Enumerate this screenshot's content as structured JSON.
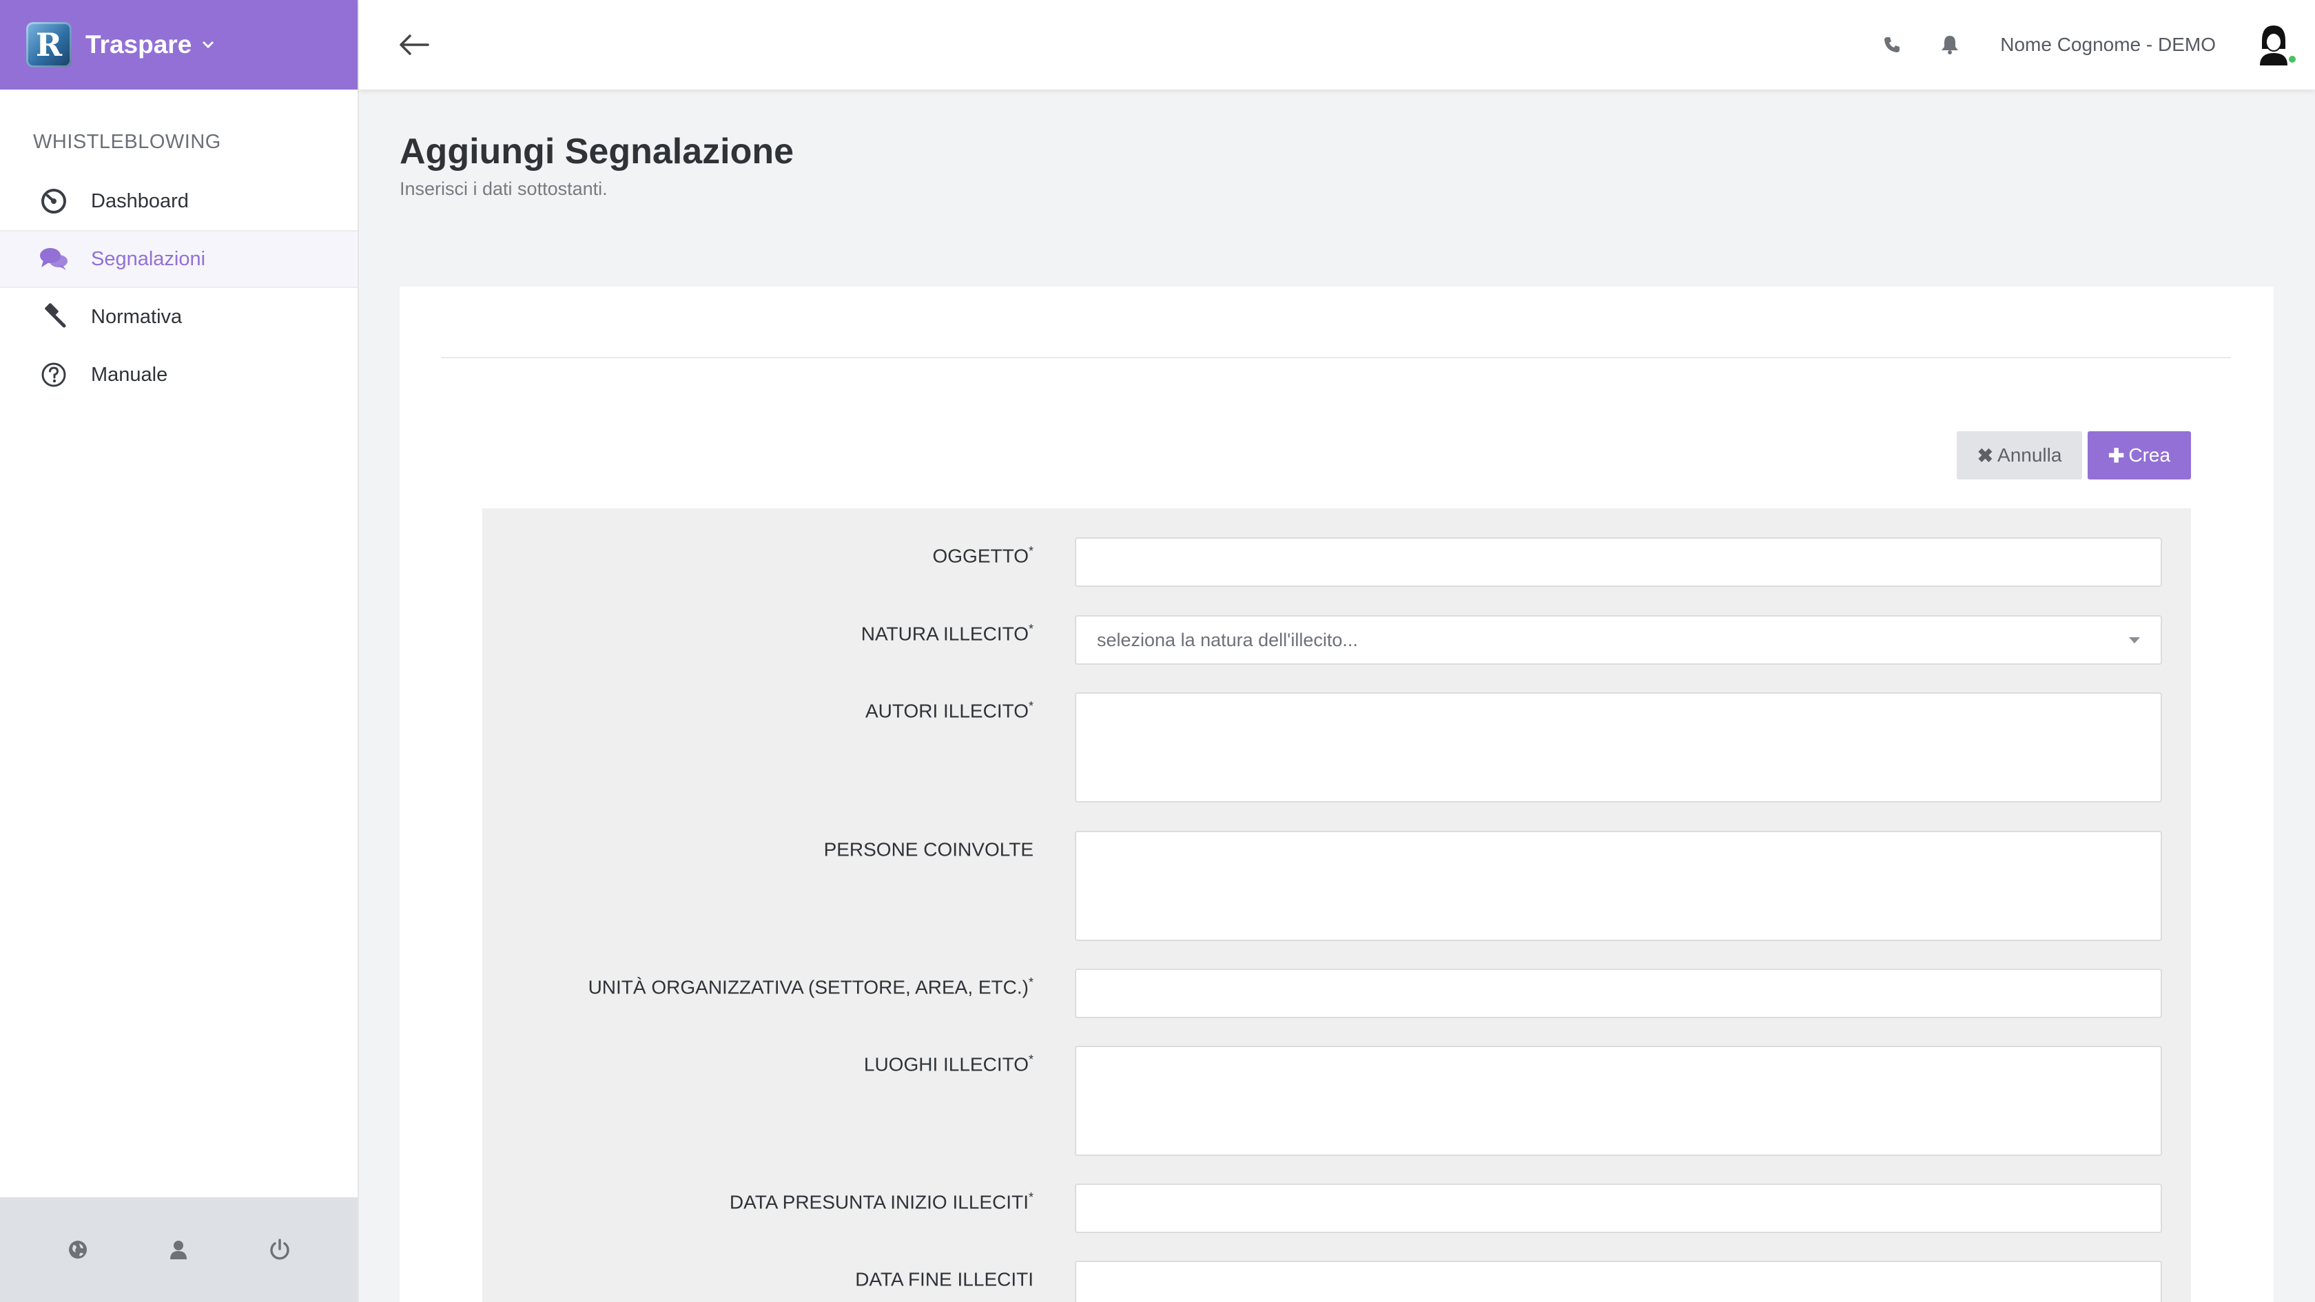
{
  "brand": {
    "name": "Traspare",
    "logo_letter": "R"
  },
  "sidebar": {
    "section_title": "WHISTLEBLOWING",
    "items": [
      {
        "label": "Dashboard",
        "icon": "dashboard-gauge-icon",
        "active": false
      },
      {
        "label": "Segnalazioni",
        "icon": "comments-icon",
        "active": true
      },
      {
        "label": "Normativa",
        "icon": "gavel-icon",
        "active": false
      },
      {
        "label": "Manuale",
        "icon": "help-circle-icon",
        "active": false
      }
    ],
    "footer_icons": [
      "globe-icon",
      "user-icon",
      "power-icon"
    ]
  },
  "topbar": {
    "user_name": "Nome Cognome - DEMO",
    "icons": [
      "back-arrow-icon",
      "phone-icon",
      "bell-icon",
      "avatar"
    ]
  },
  "page": {
    "title": "Aggiungi Segnalazione",
    "subtitle": "Inserisci i dati sottostanti."
  },
  "actions": {
    "cancel_label": "Annulla",
    "create_label": "Crea"
  },
  "form": {
    "fields": [
      {
        "label": "OGGETTO",
        "required": "*",
        "type": "input",
        "value": ""
      },
      {
        "label": "NATURA ILLECITO",
        "required": "*",
        "type": "select",
        "placeholder": "seleziona la natura dell'illecito..."
      },
      {
        "label": "AUTORI ILLECITO",
        "required": "*",
        "type": "textarea",
        "value": ""
      },
      {
        "label": "PERSONE COINVOLTE",
        "required": "",
        "type": "textarea",
        "value": ""
      },
      {
        "label": "UNITÀ ORGANIZZATIVA (SETTORE, AREA, ETC.)",
        "required": "*",
        "type": "input",
        "value": ""
      },
      {
        "label": "LUOGHI ILLECITO",
        "required": "*",
        "type": "textarea",
        "value": ""
      },
      {
        "label": "DATA PRESUNTA INIZIO ILLECITI",
        "required": "*",
        "type": "input",
        "value": ""
      },
      {
        "label": "DATA FINE ILLECITI",
        "required": "",
        "type": "input",
        "value": ""
      }
    ]
  },
  "colors": {
    "accent": "#9270d6",
    "sidebar_footer": "#dde1e5",
    "page_bg": "#f2f3f4",
    "form_panel": "#efefef"
  }
}
